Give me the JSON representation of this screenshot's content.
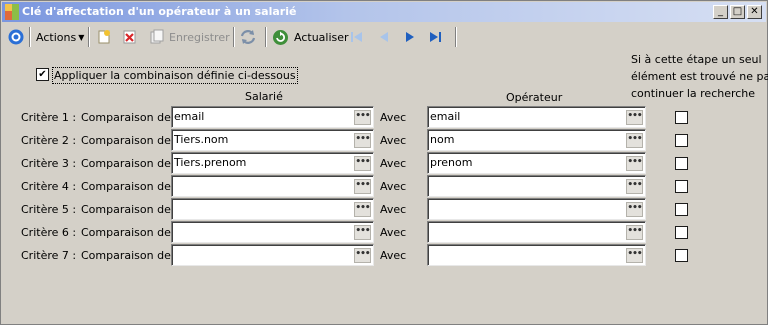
{
  "window": {
    "title": "Clé d'affectation d'un opérateur à un salarié",
    "controls": {
      "minimize": "_",
      "maximize": "□",
      "close": "✕"
    }
  },
  "toolbar": {
    "actions_label": "Actions",
    "save_label": "Enregistrer",
    "refresh_label": "Actualiser",
    "icons": [
      "target-icon",
      "new-icon",
      "delete-icon",
      "save-icon",
      "sync-icon",
      "refresh-icon",
      "first-icon",
      "previous-icon",
      "next-icon",
      "last-icon"
    ]
  },
  "form": {
    "apply_checkbox_label": "Appliquer la combinaison définie ci-dessous",
    "apply_checked": true,
    "header_salarie": "Salarié",
    "header_operateur": "Opérateur",
    "header_note": [
      "Si à cette étape un seul",
      "élément est trouvé ne pas",
      "continuer la recherche"
    ],
    "comparison_label": "Comparaison de :",
    "avec_label": "Avec",
    "dots": "•••",
    "rows": [
      {
        "label": "Critère 1 :",
        "salarie": "email",
        "operateur": "email",
        "stop": false
      },
      {
        "label": "Critère 2 :",
        "salarie": "Tiers.nom",
        "operateur": "nom",
        "stop": false
      },
      {
        "label": "Critère 3 :",
        "salarie": "Tiers.prenom",
        "operateur": "prenom",
        "stop": false
      },
      {
        "label": "Critère 4 :",
        "salarie": "",
        "operateur": "",
        "stop": false
      },
      {
        "label": "Critère 5 :",
        "salarie": "",
        "operateur": "",
        "stop": false
      },
      {
        "label": "Critère 6 :",
        "salarie": "",
        "operateur": "",
        "stop": false
      },
      {
        "label": "Critère 7 :",
        "salarie": "",
        "operateur": "",
        "stop": false
      }
    ]
  },
  "colors": {
    "accent": "#1f5fbf",
    "window_bg": "#d4d0c8"
  }
}
